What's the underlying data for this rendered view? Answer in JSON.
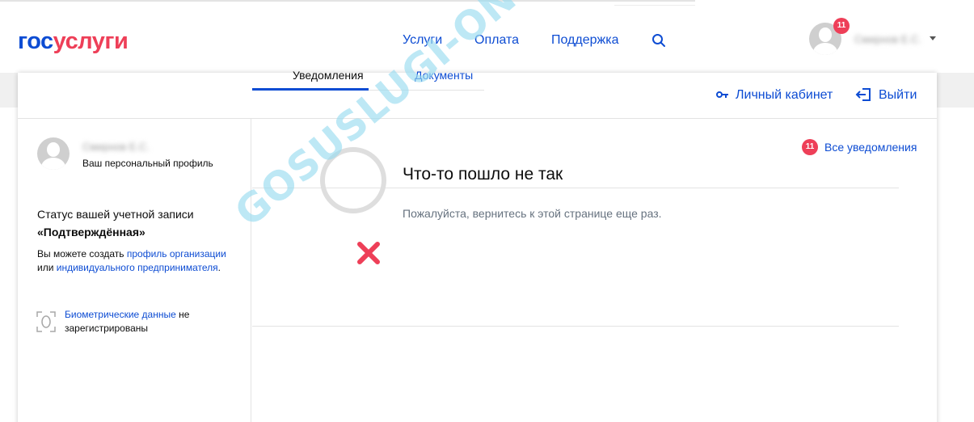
{
  "header": {
    "logo_part1": "гос",
    "logo_part2": "услуги",
    "nav": [
      "Услуги",
      "Оплата",
      "Поддержка"
    ],
    "notifications_count": "11",
    "user_name": "Смирнов Е.С."
  },
  "panel": {
    "cabinet_label": "Личный кабинет",
    "logout_label": "Выйти"
  },
  "profile": {
    "name": "Смирнов Е.С.",
    "subtitle": "Ваш персональный профиль",
    "status_label": "Статус вашей учетной записи",
    "status_value": "«Подтверждённая»",
    "create_text1": "Вы можете создать ",
    "create_link1": "профиль организации",
    "create_text2": "или ",
    "create_link2": "индивидуального предпринимателя",
    "create_text3": ".",
    "bio_link": "Биометрические данные",
    "bio_text1": " не",
    "bio_text2": "зарегистрированы"
  },
  "tabs": [
    "Уведомления",
    "Документы"
  ],
  "all_notifications": {
    "count": "11",
    "label": "Все уведомления"
  },
  "error": {
    "title": "Что-то пошло не так",
    "text": "Пожалуйста, вернитесь к этой странице еще раз."
  },
  "watermark": "GOSUSLUGI-ONLINE.RU",
  "colors": {
    "brand_blue": "#0d4cd3",
    "brand_red": "#ee3f58",
    "watermark": "#9adcf0"
  }
}
